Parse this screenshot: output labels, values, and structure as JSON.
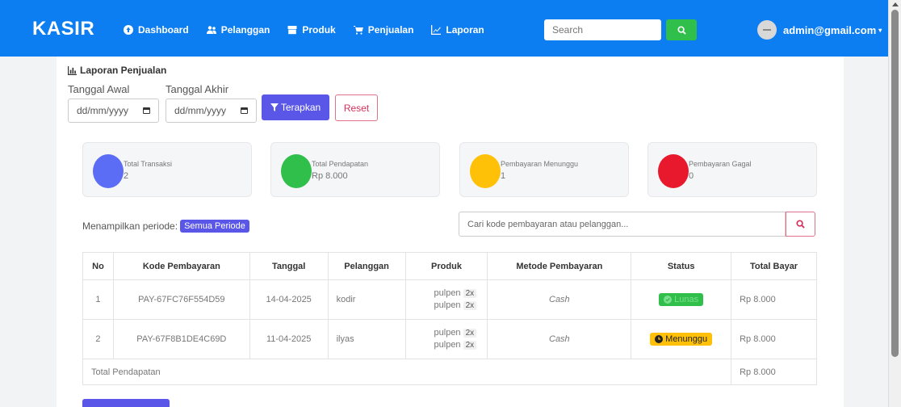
{
  "navbar": {
    "brand": "KASIR",
    "links": [
      {
        "label": "Dashboard",
        "icon": "dashboard-icon"
      },
      {
        "label": "Pelanggan",
        "icon": "users-icon"
      },
      {
        "label": "Produk",
        "icon": "box-icon"
      },
      {
        "label": "Penjualan",
        "icon": "cart-icon"
      },
      {
        "label": "Laporan",
        "icon": "chart-line-icon"
      }
    ],
    "search_placeholder": "Search",
    "user_email": "admin@gmail.com"
  },
  "report": {
    "title": "Laporan Penjualan",
    "start_label": "Tanggal Awal",
    "end_label": "Tanggal Akhir",
    "start_value": "dd/mm/yyyy",
    "end_value": "dd/mm/yyyy",
    "apply_label": "Terapkan",
    "reset_label": "Reset"
  },
  "stats": [
    {
      "label": "Total Transaksi",
      "value": "2",
      "color": "#5b6cf5"
    },
    {
      "label": "Total Pendapatan",
      "value": "Rp 8.000",
      "color": "#2fbf4a"
    },
    {
      "label": "Pembayaran Menunggu",
      "value": "1",
      "color": "#ffc107"
    },
    {
      "label": "Pembayaran Gagal",
      "value": "0",
      "color": "#e8192c"
    }
  ],
  "filter": {
    "period_prefix": "Menampilkan periode:",
    "period_value": "Semua Periode",
    "search_placeholder": "Cari kode pembayaran atau pelanggan..."
  },
  "table": {
    "headers": [
      "No",
      "Kode Pembayaran",
      "Tanggal",
      "Pelanggan",
      "Produk",
      "Metode Pembayaran",
      "Status",
      "Total Bayar"
    ],
    "rows": [
      {
        "no": "1",
        "code": "PAY-67FC76F554D59",
        "date": "14-04-2025",
        "customer": "kodir",
        "products": [
          {
            "name": "pulpen",
            "qty": "2x"
          },
          {
            "name": "pulpen",
            "qty": "2x"
          }
        ],
        "method": "Cash",
        "status": "Lunas",
        "total": "Rp 8.000"
      },
      {
        "no": "2",
        "code": "PAY-67F8B1DE4C69D",
        "date": "11-04-2025",
        "customer": "ilyas",
        "products": [
          {
            "name": "pulpen",
            "qty": "2x"
          },
          {
            "name": "pulpen",
            "qty": "2x"
          }
        ],
        "method": "Cash",
        "status": "Menunggu",
        "total": "Rp 8.000"
      }
    ],
    "footer_label": "Total Pendapatan",
    "footer_total": "Rp 8.000"
  },
  "colors": {
    "navbar": "#0d7ef2",
    "primary": "#5a56e8",
    "success": "#2fbf4a",
    "warning": "#ffc107",
    "danger": "#e8192c"
  }
}
